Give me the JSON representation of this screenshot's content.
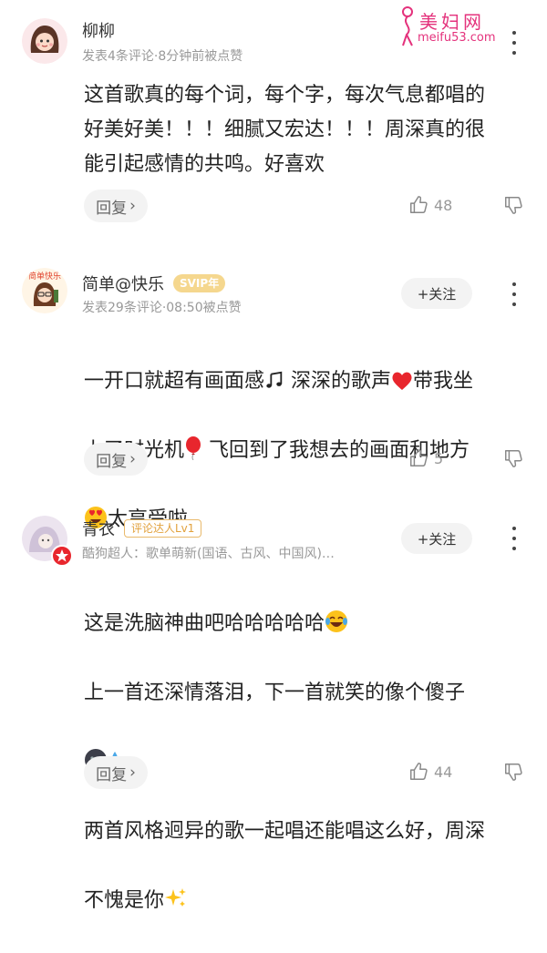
{
  "watermark": {
    "title": "美妇网",
    "url": "meifu53.com"
  },
  "comments": [
    {
      "username": "柳柳",
      "badge": "",
      "meta": "发表4条评论·8分钟前被点赞",
      "lines": [
        "这首歌真的每个词，每个字，每次气息都唱的",
        "好美好美！！！细腻又宏达！！！周深真的很",
        "能引起感情的共鸣。好喜欢"
      ],
      "follow": "",
      "reply": "回复",
      "likes": "48"
    },
    {
      "username": "简单@快乐",
      "badge": "SVIP年",
      "meta": "发表29条评论·08:50被点赞",
      "lines": [
        "一开口就超有画面感",
        "深深的歌声",
        "带我坐",
        "上了时光机",
        "飞回到了我想去的画面和地方",
        "太享受啦"
      ],
      "follow": "+关注",
      "reply": "回复",
      "likes": "5"
    },
    {
      "username": "青衣",
      "badge": "评论达人Lv1",
      "meta": "酷狗超人：歌单萌新(国语、古风、中国风)…",
      "lines": [
        "这是洗脑神曲吧哈哈哈哈哈",
        "上一首还深情落泪，下一首就笑的像个傻子",
        "两首风格迥异的歌一起唱还能唱这么好，周深",
        "不愧是你"
      ],
      "follow": "+关注",
      "reply": "回复",
      "likes": "44"
    }
  ],
  "avatar_text": "简单快乐",
  "icons": [
    "more-icon",
    "thumb-up-icon",
    "thumb-down-icon",
    "music-note-emoji",
    "heart-emoji",
    "balloon-emoji",
    "heart-eyes-emoji",
    "tears-of-joy-emoji",
    "dark-face-emoji",
    "sweat-drops-emoji",
    "sparkles-emoji"
  ],
  "colors": {
    "accent": "#e4327c",
    "svip": "#f5d78e",
    "talent": "#e2a13c",
    "meta": "#999999"
  }
}
